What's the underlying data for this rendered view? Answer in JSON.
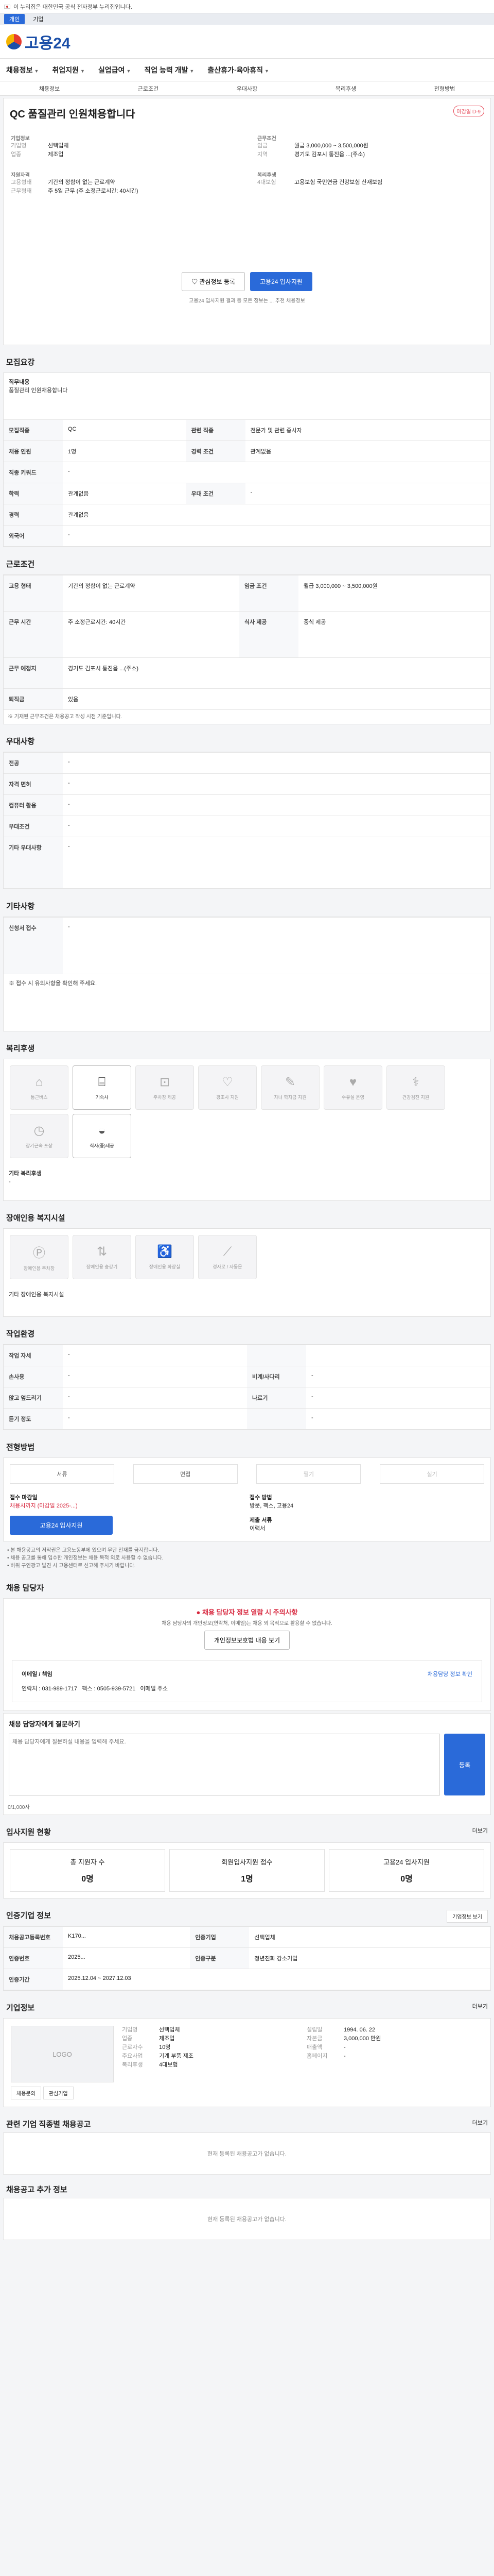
{
  "gov_banner": "이 누리집은 대한민국 공식 전자정부 누리집입니다.",
  "site_tabs": [
    "개인",
    "기업"
  ],
  "logo_text": "고용24",
  "nav": [
    "채용정보",
    "취업지원",
    "실업급여",
    "직업 능력 개발",
    "출산휴가·육아휴직"
  ],
  "subnav": [
    "채용정보",
    "근로조건",
    "우대사항",
    "복리후생",
    "전형방법"
  ],
  "job": {
    "title": "QC 품질관리 인원채용합니다",
    "badge": "마감일 D-9",
    "company_lbl": "기업정보",
    "company_rows": [
      [
        "기업명",
        "선택업체"
      ],
      [
        "업종",
        "제조업"
      ]
    ],
    "cond_lbl": "근무조건",
    "cond_rows": [
      [
        "임금",
        "월급 3,000,000 ~ 3,500,000원"
      ],
      [
        "지역",
        "경기도 김포시 통진읍 ...(주소)"
      ]
    ],
    "req_lbl": "지원자격",
    "req_rows": [
      [
        "고용형태",
        "기간의 정함이 없는 근로계약"
      ],
      [
        "근무형태",
        "주 5일 근무 (주 소정근로시간: 40시간)"
      ]
    ],
    "emp_lbl": "복리후생",
    "emp_rows": [
      [
        "4대보험",
        "고용보험 국민연금 건강보험 산재보험"
      ]
    ]
  },
  "apply": {
    "btn1": "관심정보 등록",
    "btn2": "고용24 입사지원",
    "note": "고용24 입사지원 결과 등 모든 정보는 ... 추천 채용정보"
  },
  "recruit": {
    "title": "모집요강",
    "duty_h": "직무내용",
    "duty": "품질관리 인원채용합니다",
    "rows": [
      [
        "모집직종",
        "QC"
      ],
      [
        "채용 인원",
        "1명"
      ],
      [
        "직종 키워드",
        "-"
      ],
      [
        "학력",
        "관계없음"
      ],
      [
        "경력",
        "관계없음"
      ],
      [
        "외국어",
        "-"
      ]
    ],
    "extra": [
      [
        "관련 직종",
        "전문가 및 관련 종사자"
      ],
      [
        "경력 조건",
        "관계없음"
      ],
      [
        "우대 조건",
        "-"
      ]
    ]
  },
  "work": {
    "title": "근로조건",
    "rows": [
      [
        "고용 형태",
        "기간의 정함이 없는 근로계약"
      ],
      [
        "임금 조건",
        "월급 3,000,000 ~ 3,500,000원"
      ],
      [
        "근무 시간",
        "주 소정근로시간: 40시간"
      ],
      [
        "근무 예정지",
        "경기도 김포시 통진읍 ...(주소)"
      ],
      [
        "식사 제공",
        "중식 제공"
      ],
      [
        "퇴직금",
        "있음"
      ]
    ],
    "note": "※ 기재된 근무조건은 채용공고 작성 시점 기준입니다."
  },
  "pref": {
    "title": "우대사항",
    "rows": [
      [
        "전공",
        "-"
      ],
      [
        "자격 면허",
        "-"
      ],
      [
        "컴퓨터 활용",
        "-"
      ],
      [
        "우대조건",
        "-"
      ],
      [
        "기타 우대사항",
        "-"
      ]
    ]
  },
  "other": {
    "title": "기타사항",
    "rows": [
      [
        "신청서 접수",
        "-"
      ]
    ],
    "box": "※ 접수 시 유의사항을 확인해 주세요."
  },
  "welfare": {
    "title": "복리후생",
    "items": [
      {
        "icon": "house",
        "label": "통근버스",
        "on": false
      },
      {
        "icon": "meal",
        "label": "기숙사",
        "on": true
      },
      {
        "icon": "car",
        "label": "주차장 제공",
        "on": false
      },
      {
        "icon": "gift",
        "label": "경조사 지원",
        "on": false
      },
      {
        "icon": "edu",
        "label": "자녀 학자금 지원",
        "on": false
      },
      {
        "icon": "heart",
        "label": "수유실 운영",
        "on": false
      },
      {
        "icon": "rest",
        "label": "건강검진 지원",
        "on": false
      },
      {
        "icon": "clock",
        "label": "장기근속 포상",
        "on": false
      },
      {
        "icon": "bowl",
        "label": "식사(중)제공",
        "on": true
      }
    ],
    "other_lbl": "기타 복리후생",
    "other_val": "-"
  },
  "disability": {
    "title": "장애인용 복지시설",
    "items": [
      "장애인용 주차장",
      "장애인용 승강기",
      "장애인용 화장실",
      "경사로 / 자동문"
    ],
    "other": "기타 장애인용 복지시설"
  },
  "work_env": {
    "title": "작업환경",
    "rows": [
      [
        "작업 자세",
        "-",
        "",
        ""
      ],
      [
        "손사용",
        "-",
        "비계/사다리",
        "-"
      ],
      [
        "앉고 엎드리기",
        "-",
        "나르기",
        "-"
      ],
      [
        "듣기 정도",
        "-",
        "",
        "-"
      ]
    ]
  },
  "selection": {
    "title": "전형방법",
    "steps": [
      "서류",
      "면접",
      "필기",
      "실기"
    ],
    "rows": [
      [
        "접수 마감일",
        "채용시까지 (마감일 2025-...)"
      ],
      [
        "접수 방법",
        "방문, 팩스, 고용24"
      ],
      [
        "제출 서류",
        "이력서"
      ]
    ],
    "apply_btn": "고용24 입사지원"
  },
  "notices": [
    "• 본 채용공고의 저작권은 고용노동부에 있으며 무단 전재를 금지합니다.",
    "• 채용 공고를 통해 입수한 개인정보는 채용 목적 외로 사용할 수 없습니다.",
    "• 허위 구인광고 발견 시 고용센터로 신고해 주시기 바랍니다."
  ],
  "contact": {
    "title": "채용 담당자",
    "warn_title": "채용 담당자 정보 열람 시 주의사항",
    "warn_body": "채용 담당자의 개인정보(연락처, 이메일)는 채용 외 목적으로 활용할 수 없습니다.",
    "warn_btn": "개인정보보호법 내용 보기",
    "name_h": "이메일 / 책임",
    "phone": "연락처 : 031-989-1717",
    "fax": "팩스 : 0505-939-5721",
    "email": "이메일 주소",
    "hl": "채용담당 정보 확인"
  },
  "inquiry": {
    "title": "채용 담당자에게 질문하기",
    "hint": "0/1,000자",
    "placeholder": "채용 담당자에게 질문하실 내용을 입력해 주세요.",
    "btn": "등록",
    "count": "0/1,000자"
  },
  "status": {
    "title": "입사지원 현황",
    "more": "더보기",
    "cards": [
      [
        "총 지원자 수",
        "0명"
      ],
      [
        "회원입사지원 접수",
        "1명"
      ],
      [
        "고용24 입사지원",
        "0명"
      ]
    ]
  },
  "info": {
    "title": "인증기업 정보",
    "btn": "기업정보 보기",
    "rows": [
      [
        "채용공고등록번호",
        "K170...",
        "인증기업",
        "선택업체"
      ],
      [
        "인증번호",
        "2025...",
        "인증구분",
        "청년친화 강소기업"
      ],
      [
        "인증기간",
        "2025.12.04 ~ 2027.12.03",
        "",
        "-"
      ]
    ]
  },
  "company": {
    "title": "기업정보",
    "more": "더보기",
    "logo": "LOGO",
    "btns": [
      "채용문의",
      "관심기업"
    ],
    "rows": [
      [
        "기업명",
        "선택업체"
      ],
      [
        "업종",
        "제조업"
      ],
      [
        "근로자수",
        "10명"
      ],
      [
        "주요사업",
        "기계 부품 제조"
      ],
      [
        "복리후생",
        "4대보험"
      ]
    ],
    "right": [
      [
        "설립일",
        "1994. 06. 22"
      ],
      [
        "자본금",
        "3,000,000 만원"
      ],
      [
        "매출액",
        "-"
      ],
      [
        "홈페이지",
        "-"
      ]
    ]
  },
  "similar": {
    "title": "관련 기업 직종별 채용공고",
    "more": "더보기",
    "empty": "현재 등록된 채용공고가 없습니다."
  },
  "recent": {
    "title": "채용공고 추가 정보",
    "empty": "현재 등록된 채용공고가 없습니다."
  }
}
